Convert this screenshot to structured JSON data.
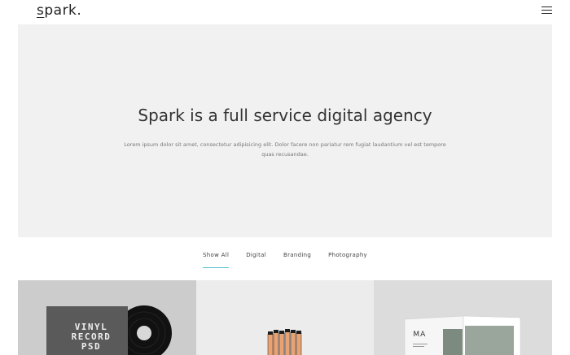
{
  "header": {
    "logo_text": "spark.",
    "menu_icon": "hamburger-menu-icon"
  },
  "hero": {
    "title": "Spark is a full service digital agency",
    "description": "Lorem ipsum dolor sit amet, consectetur adipisicing elit. Dolor facere non pariatur rem fugiat laudantium vel est tempore quas recusandae."
  },
  "filters": {
    "items": [
      "Show All",
      "Digital",
      "Branding",
      "Photography"
    ],
    "active": "Show All",
    "accent_color": "#5bbfd2"
  },
  "portfolio": {
    "tiles": [
      {
        "name": "vinyl-record-psd",
        "text": "VINYL RECORD PSD"
      },
      {
        "name": "pencils-photo"
      },
      {
        "name": "magazine-mockup",
        "text": "MA"
      }
    ]
  }
}
